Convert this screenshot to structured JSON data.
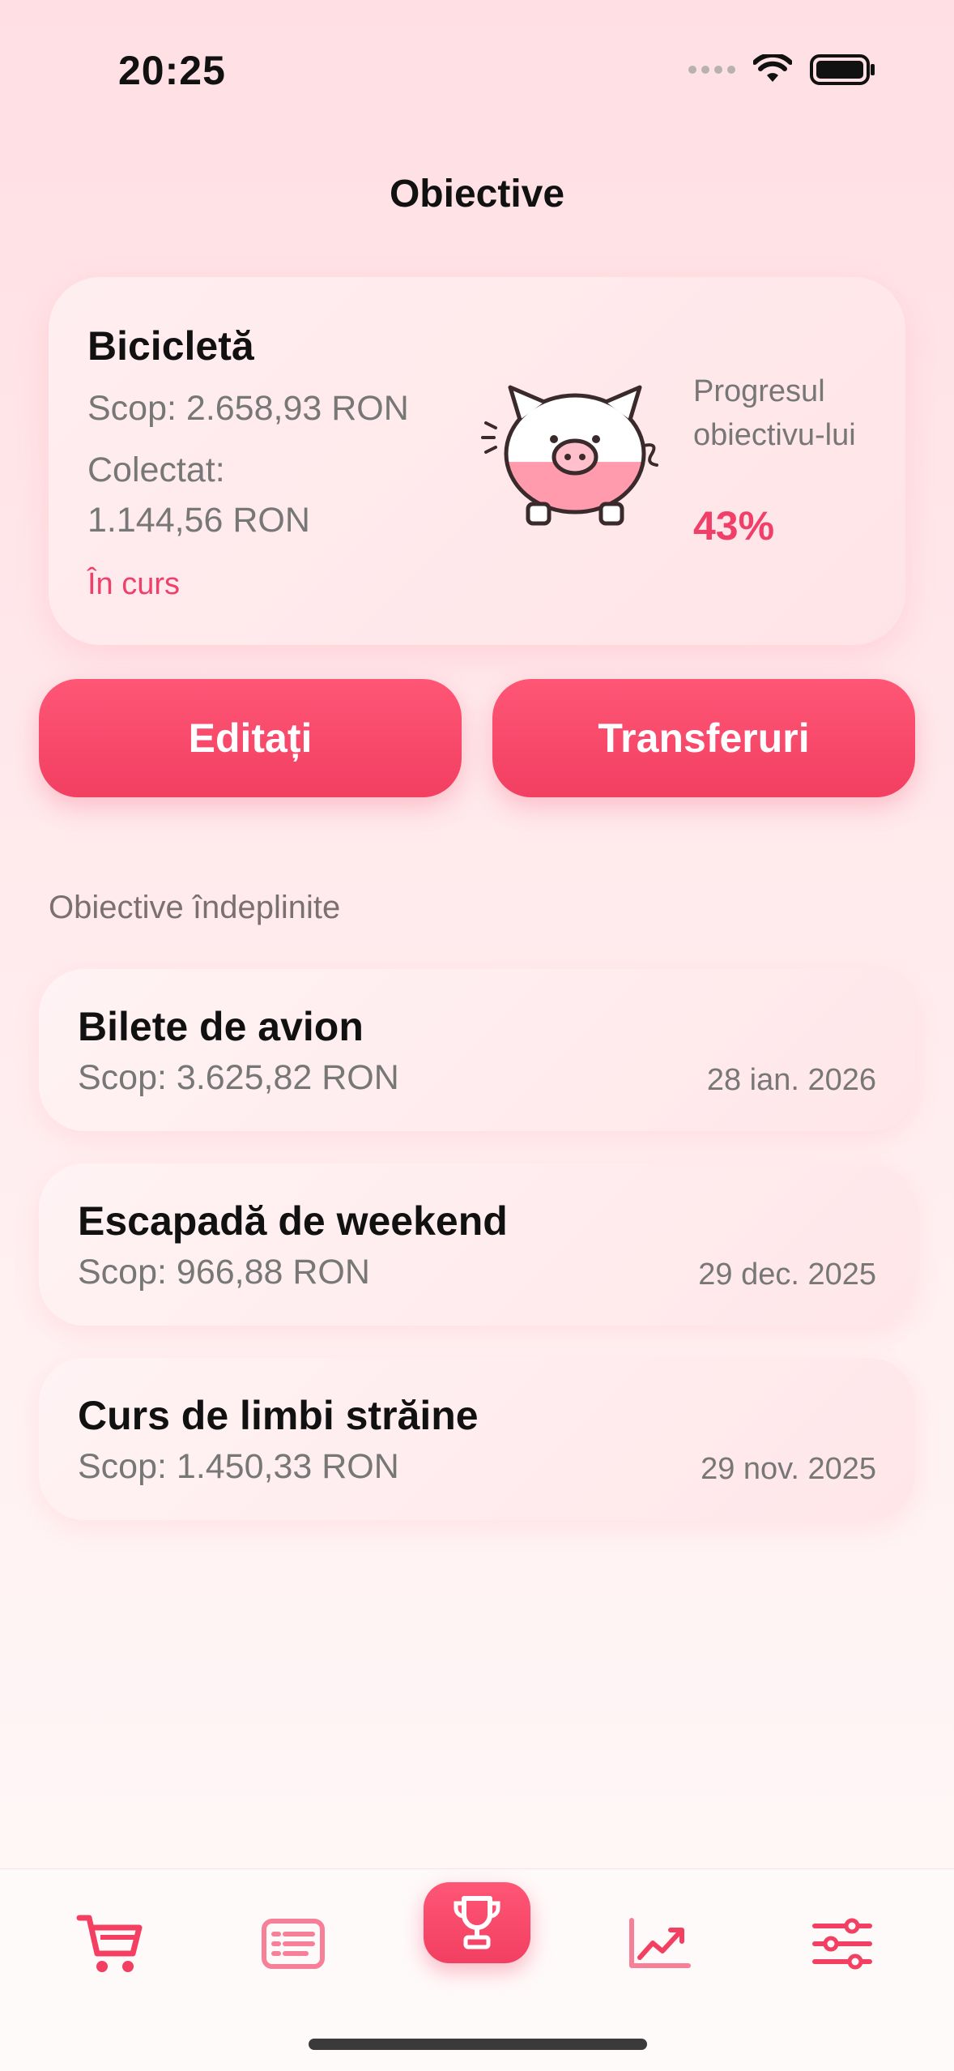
{
  "status_bar": {
    "time": "20:25"
  },
  "header": {
    "title": "Obiective"
  },
  "current_goal": {
    "name": "Bicicletă",
    "target": "Scop: 2.658,93 RON",
    "collected_label": "Colectat:",
    "collected_value": "1.144,56 RON",
    "status": "În curs",
    "progress_label": "Progresul obiectivu-lui",
    "progress_value": "43%",
    "progress_fraction": 0.43
  },
  "actions": {
    "edit_label": "Editați",
    "transfers_label": "Transferuri"
  },
  "completed_section": {
    "title": "Obiective îndeplinite",
    "items": [
      {
        "name": "Bilete de avion",
        "target": "Scop: 3.625,82 RON",
        "date": "28 ian. 2026"
      },
      {
        "name": "Escapadă de weekend",
        "target": "Scop: 966,88 RON",
        "date": "29 dec. 2025"
      },
      {
        "name": "Curs de limbi străine",
        "target": "Scop: 1.450,33 RON",
        "date": "29 nov. 2025"
      }
    ]
  },
  "tab_bar": {
    "tabs": [
      {
        "icon": "cart-icon",
        "active": false
      },
      {
        "icon": "list-icon",
        "active": false
      },
      {
        "icon": "trophy-icon",
        "active": true
      },
      {
        "icon": "chart-icon",
        "active": false
      },
      {
        "icon": "sliders-icon",
        "active": false
      }
    ]
  },
  "colors": {
    "accent": "#f23f62",
    "accent_light": "#ff5676",
    "text_secondary": "#777777"
  }
}
